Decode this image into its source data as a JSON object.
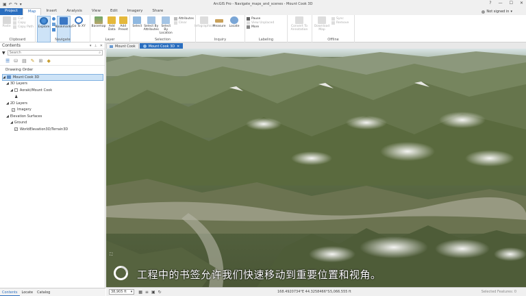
{
  "window": {
    "title": "ArcGIS Pro - Navigate_maps_and_scenes - Mount Cook 3D",
    "help": "?",
    "minimize": "—",
    "maximize": "☐",
    "close": "✕"
  },
  "qat": [
    "▣",
    "↶",
    "↷",
    "▾"
  ],
  "tabs": [
    "Project",
    "Map",
    "Insert",
    "Analysis",
    "View",
    "Edit",
    "Imagery",
    "Share"
  ],
  "active_tab": "Map",
  "user": {
    "label": "Not signed in",
    "caret": "▾"
  },
  "ribbon": {
    "clipboard": {
      "label": "Clipboard",
      "paste": "Paste",
      "cut": "Cut",
      "copy": "Copy",
      "copy_path": "Copy Path"
    },
    "navigate": {
      "label": "Navigate",
      "explore": "Explore",
      "bookmarks": "Bookmarks",
      "goto": "Go To XY"
    },
    "layer": {
      "label": "Layer",
      "basemap": "Basemap",
      "add_data": "Add Data",
      "add_preset": "Add Preset"
    },
    "selection": {
      "label": "Selection",
      "select": "Select",
      "by_attr": "Select By Attributes",
      "by_loc": "Select By Location",
      "attributes": "Attributes",
      "clear": "Clear"
    },
    "inquiry": {
      "label": "Inquiry",
      "infographics": "Infographics",
      "measure": "Measure",
      "locate": "Locate"
    },
    "labeling": {
      "label": "Labeling",
      "pause": "Pause",
      "view_unplaced": "View Unplaced",
      "more": "More",
      "convert": "Convert To Annotation"
    },
    "offline": {
      "label": "Offline",
      "download": "Download Map",
      "sync": "Sync",
      "remove": "Remove"
    }
  },
  "contents": {
    "title": "Contents",
    "search_placeholder": "Search",
    "drawing_order": "Drawing Order",
    "scene_name": "Mount Cook 3D",
    "layers_3d": "3D Layers",
    "layer_aoraki": "Aoraki/Mount Cook",
    "layers_2d": "2D Layers",
    "layer_imagery": "Imagery",
    "elevation_surfaces": "Elevation Surfaces",
    "ground": "Ground",
    "terrain": "WorldElevation3D/Terrain3D"
  },
  "bottom_tabs": [
    "Contents",
    "Locate",
    "Catalog"
  ],
  "view_tabs": [
    {
      "label": "Mount Cook",
      "close": ""
    },
    {
      "label": "Mount Cook 3D",
      "close": "✕"
    }
  ],
  "status": {
    "scale": "38,905 ft",
    "coords": "168.4920734°E 44.3258466°S",
    "elevation": "5,066.555 ft",
    "selected": "Selected Features: 0"
  },
  "subtitle": "工程中的书签允许我们快速移动到重要位置和视角。",
  "colors": {
    "accent": "#2a6ebf",
    "selection": "#cde3f7"
  }
}
